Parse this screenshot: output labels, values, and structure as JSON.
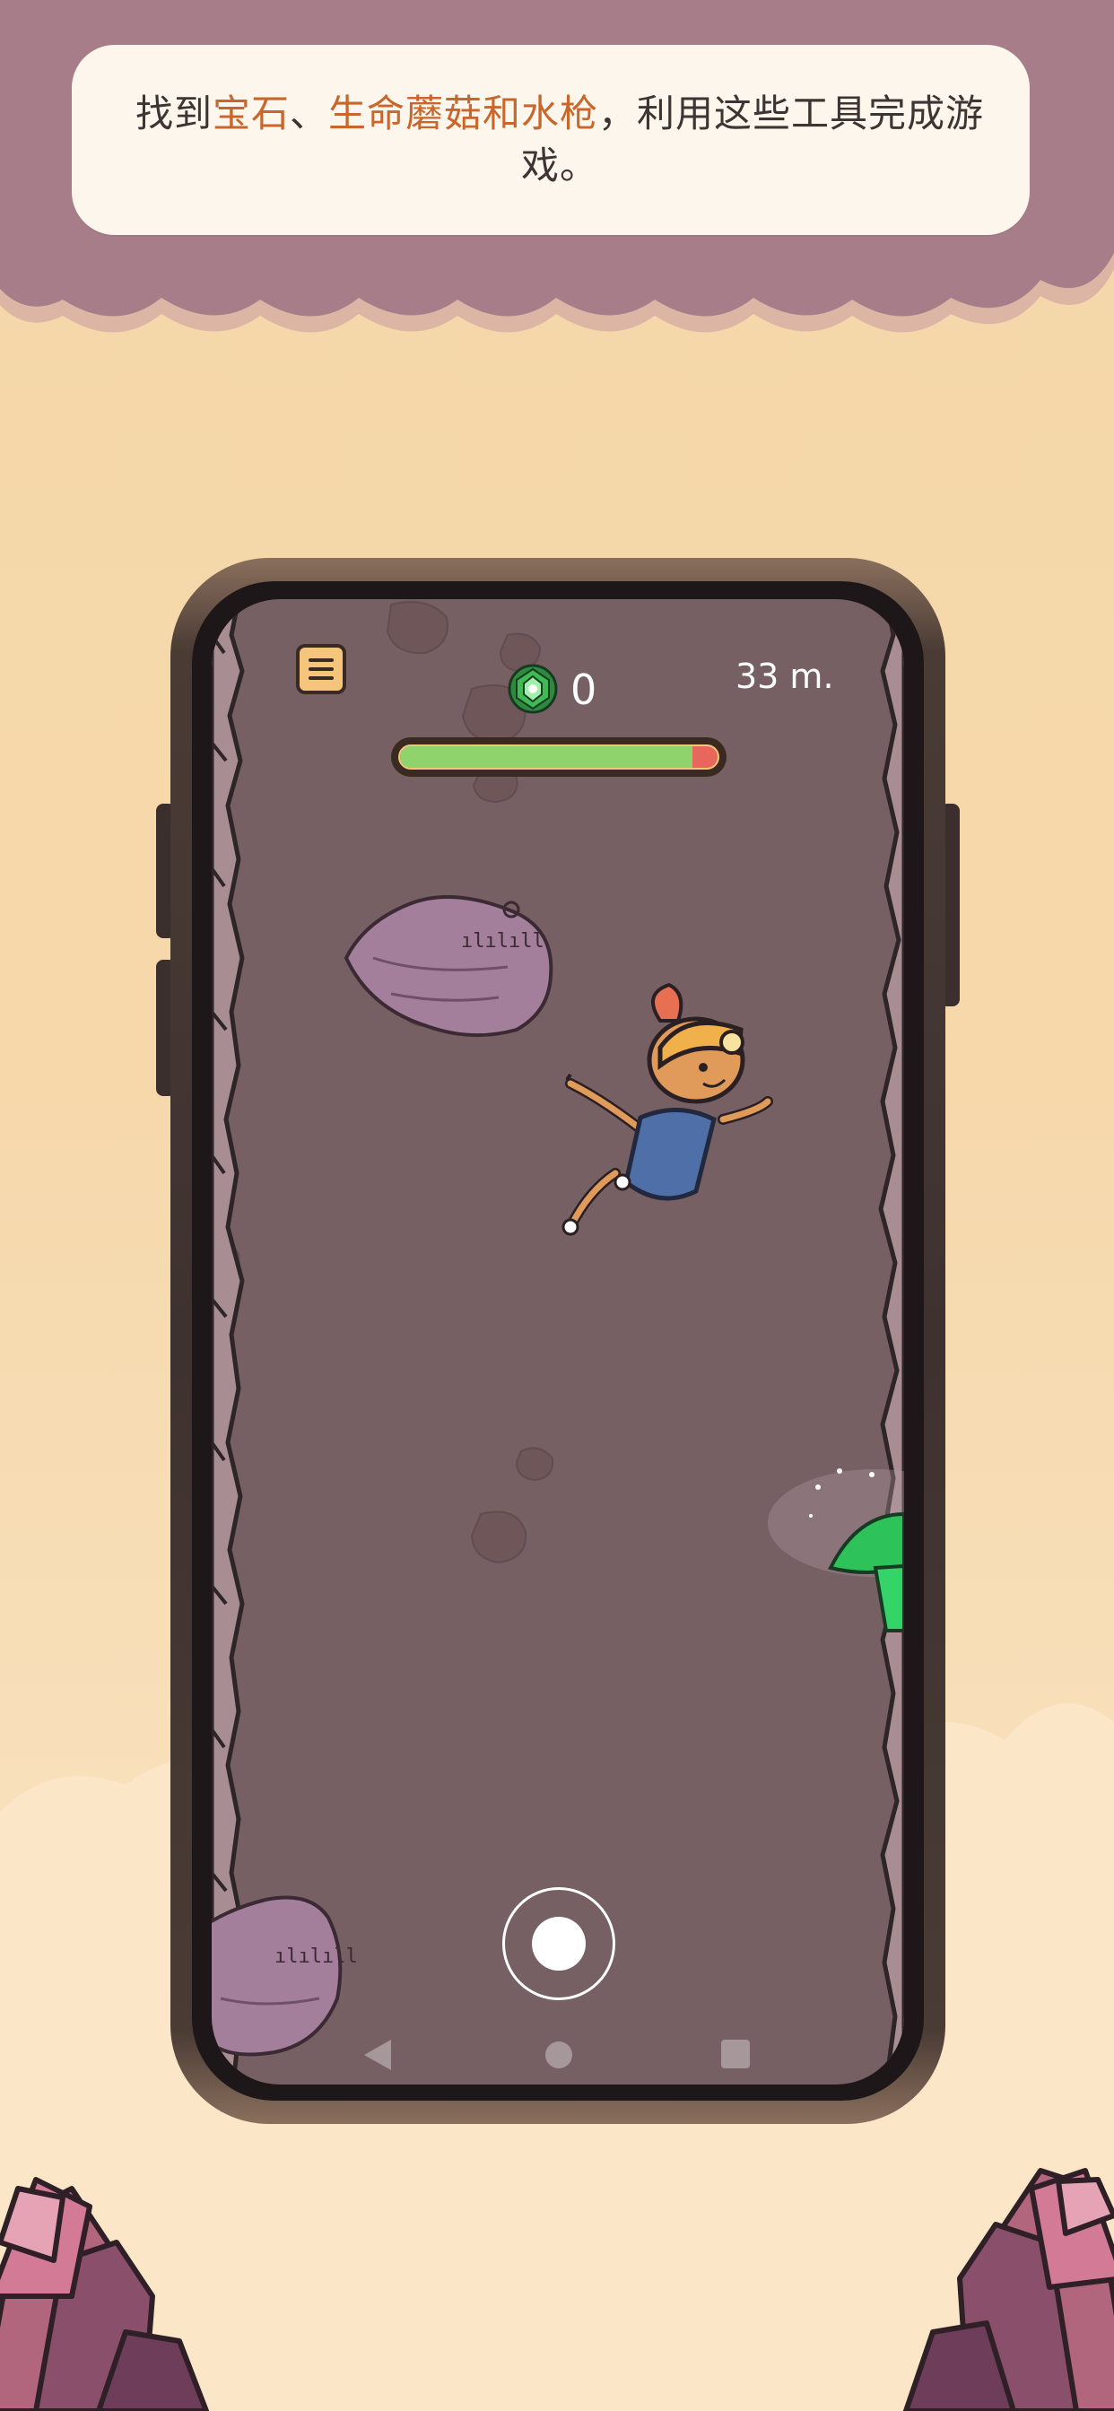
{
  "caption": {
    "part1": "找到",
    "highlight1": "宝石",
    "part2": "、",
    "highlight2": "生命蘑菇",
    "part3": "和",
    "highlight3": "水枪",
    "part4": "，利用这些工具完成游戏。"
  },
  "hud": {
    "menu_icon": "hamburger-menu-icon",
    "gem_icon": "green-gem-icon",
    "gem_count": "0",
    "depth": "33 m.",
    "health_fraction": 0.92
  },
  "controls": {
    "action_button_icon": "circle-action-icon"
  },
  "nav_bar": {
    "back_icon": "triangle-back-icon",
    "home_icon": "circle-home-icon",
    "recent_icon": "square-recent-icon"
  },
  "colors": {
    "highlight": "#c8662c",
    "cave_wall": "#776064",
    "health_green": "#8ed36c",
    "health_red": "#e9665c",
    "mushroom_green": "#2ec25a"
  }
}
